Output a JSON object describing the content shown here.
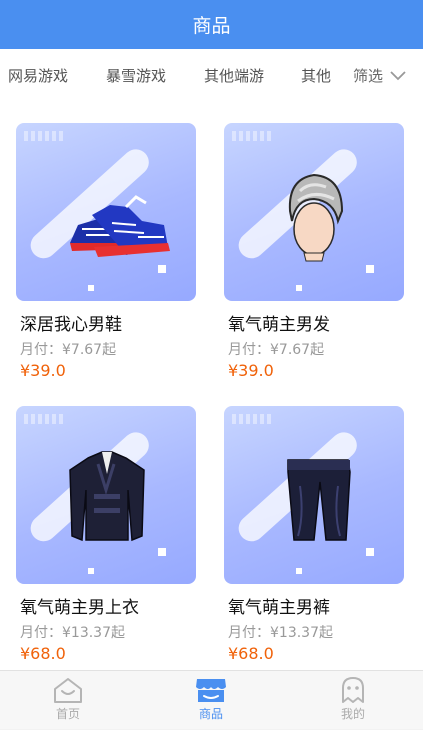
{
  "header": {
    "title": "商品"
  },
  "categories": [
    "网易游戏",
    "暴雪游戏",
    "其他端游",
    "其他"
  ],
  "filter": {
    "label": "筛选"
  },
  "products": [
    {
      "name": "深居我心男鞋",
      "monthly": "月付：¥7.67起",
      "price": "¥39.0",
      "icon": "sneaker-icon"
    },
    {
      "name": "氧气萌主男发",
      "monthly": "月付：¥7.67起",
      "price": "¥39.0",
      "icon": "hair-icon"
    },
    {
      "name": "氧气萌主男上衣",
      "monthly": "月付：¥13.37起",
      "price": "¥68.0",
      "icon": "jacket-icon"
    },
    {
      "name": "氧气萌主男裤",
      "monthly": "月付：¥13.37起",
      "price": "¥68.0",
      "icon": "pants-icon"
    }
  ],
  "tabbar": [
    {
      "label": "首页",
      "icon": "home-icon"
    },
    {
      "label": "商品",
      "icon": "shop-icon",
      "active": true
    },
    {
      "label": "我的",
      "icon": "profile-icon"
    }
  ],
  "colors": {
    "primary": "#4a8ff0",
    "price": "#f0620a"
  }
}
